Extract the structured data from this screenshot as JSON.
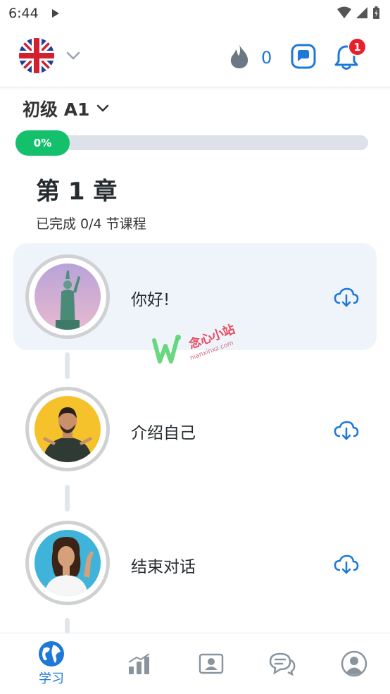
{
  "status_bar": {
    "time": "6:44"
  },
  "header": {
    "language_flag": "uk-flag",
    "streak_count": "0",
    "notification_badge": "1"
  },
  "level": {
    "label": "初级 A1",
    "progress_text": "0%",
    "progress_fraction": 0.0
  },
  "chapter": {
    "title": "第 1 章",
    "subtitle": "已完成 0/4 节课程"
  },
  "lessons": [
    {
      "title": "你好!",
      "image": "statue-of-liberty",
      "highlighted": true
    },
    {
      "title": "介绍自己",
      "image": "man-pointing",
      "highlighted": false
    },
    {
      "title": "结束对话",
      "image": "woman-waving",
      "highlighted": false
    }
  ],
  "watermark": {
    "text": "念心小站",
    "subtext": "nianxinxz.com"
  },
  "bottom_nav": [
    {
      "label": "学习",
      "icon": "globe-icon",
      "active": true
    },
    {
      "label": "",
      "icon": "chart-icon",
      "active": false
    },
    {
      "label": "",
      "icon": "profile-card-icon",
      "active": false
    },
    {
      "label": "",
      "icon": "community-chat-icon",
      "active": false
    },
    {
      "label": "",
      "icon": "user-avatar-icon",
      "active": false
    }
  ],
  "colors": {
    "accent_blue": "#1d78d8",
    "progress_green": "#14c06b",
    "badge_red": "#e8202c",
    "highlight_bg": "#eff4fb"
  }
}
